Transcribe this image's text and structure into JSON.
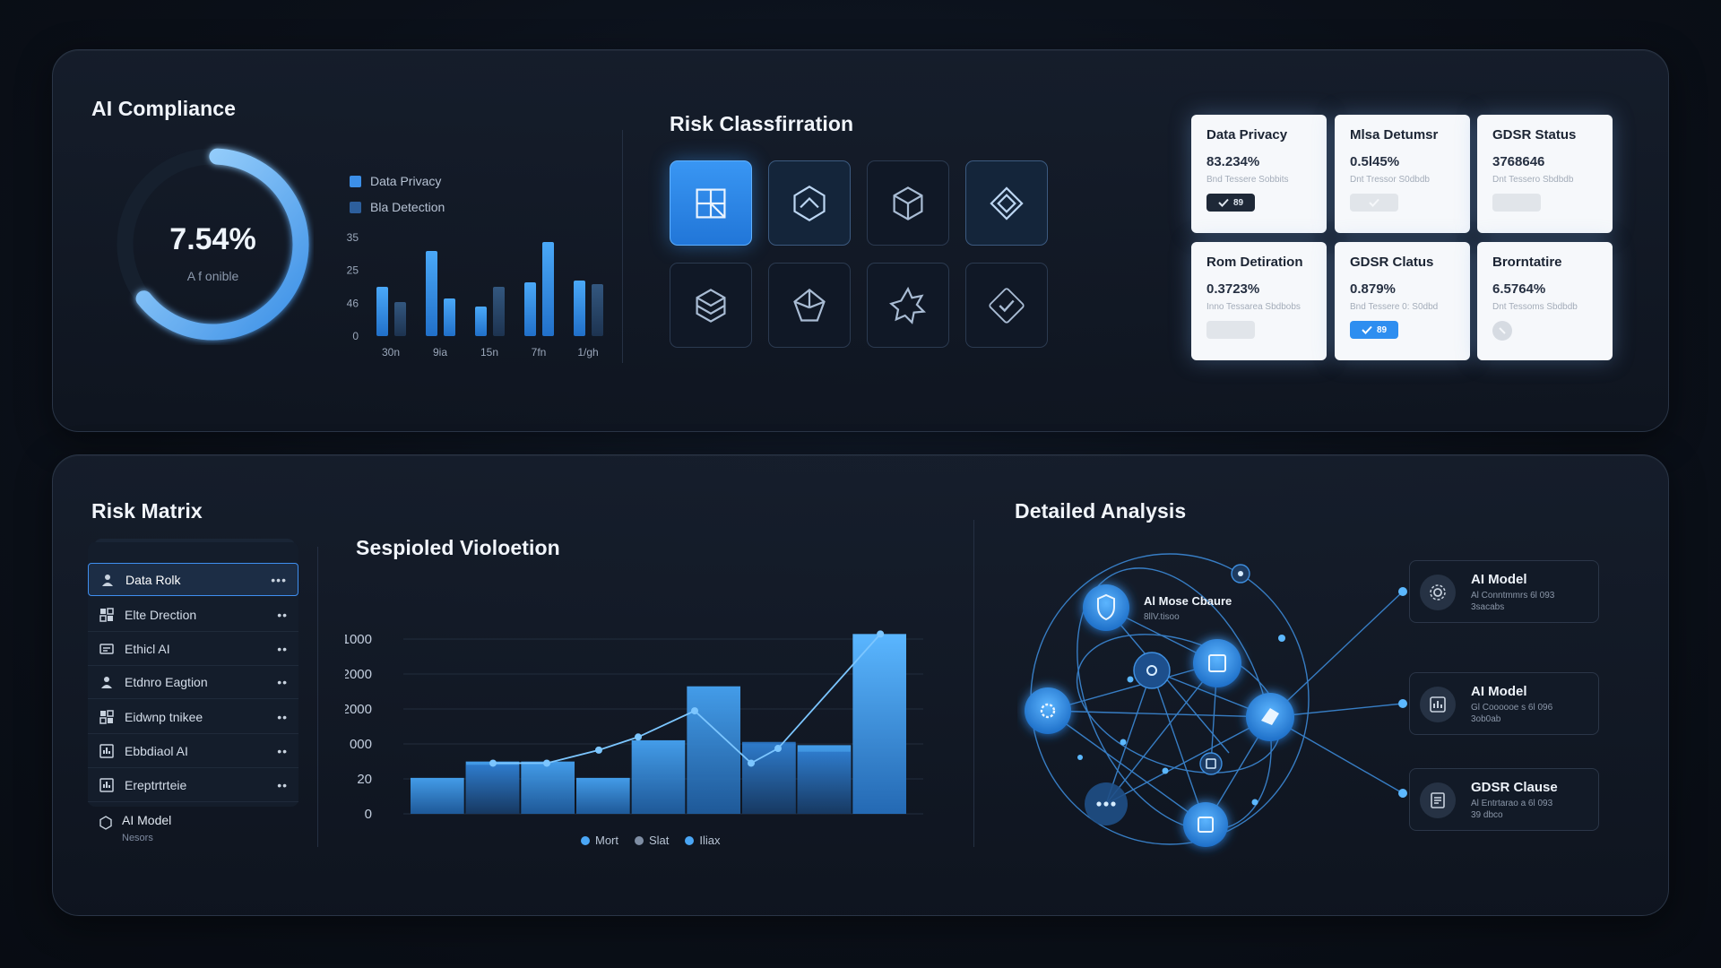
{
  "compliance": {
    "title": "AI Compliance",
    "gauge_value": "7.54%",
    "gauge_fraction": 0.58,
    "gauge_sub": "A f onible",
    "legend": [
      {
        "label": "Data Privacy",
        "color": "#3c8fe8"
      },
      {
        "label": "Bla Detection",
        "color": "#2d5f9c"
      }
    ]
  },
  "risk_classification": {
    "title": "Risk Classfirration",
    "tiles": [
      {
        "icon": "layout-blocks-icon",
        "state": "active"
      },
      {
        "icon": "hexagon-chevron-icon",
        "state": "highlight"
      },
      {
        "icon": "isometric-cube-icon",
        "state": "normal"
      },
      {
        "icon": "rotated-diamond-icon",
        "state": "highlight"
      },
      {
        "icon": "hexagon-layers-icon",
        "state": "normal"
      },
      {
        "icon": "prism-icon",
        "state": "normal"
      },
      {
        "icon": "gear-star-icon",
        "state": "normal"
      },
      {
        "icon": "shield-check-icon",
        "state": "normal"
      }
    ]
  },
  "status_cards": [
    {
      "title": "Data Privacy",
      "value": "83.234%",
      "sub": "Bnd Tessere Sobbits",
      "badge": "check-dark",
      "badge_text": "89"
    },
    {
      "title": "Mlsa Detumsr",
      "value": "0.5l45%",
      "sub": "Dnt Tressor S0dbdb",
      "badge": "grey",
      "badge_text": ""
    },
    {
      "title": "GDSR Status",
      "value": "3768646",
      "sub": "Dnt Tessero Sbdbdb",
      "badge": "grey",
      "badge_text": ""
    },
    {
      "title": "Rom Detiration",
      "value": "0.3723%",
      "sub": "Inno Tessarea Sbdbobs",
      "badge": "grey",
      "badge_text": ""
    },
    {
      "title": "GDSR Clatus",
      "value": "0.879%",
      "sub": "Bnd Tessere 0: S0dbd",
      "badge": "check-blue",
      "badge_text": "89"
    },
    {
      "title": "Brorntatire",
      "value": "6.5764%",
      "sub": "Dnt Tessoms Sbdbdb",
      "badge": "dot",
      "badge_text": ""
    }
  ],
  "risk_matrix": {
    "title": "Risk Matrix",
    "items": [
      {
        "label": "Data Rolk",
        "icon": "users-icon",
        "selected": true
      },
      {
        "label": "Elte Drection",
        "icon": "grid-chart-icon",
        "selected": false
      },
      {
        "label": "Ethicl AI",
        "icon": "id-card-icon",
        "selected": false
      },
      {
        "label": "Etdnro Eagtion",
        "icon": "users-icon",
        "selected": false
      },
      {
        "label": "Eidwnp tnikee",
        "icon": "grid-chart-icon",
        "selected": false
      },
      {
        "label": "Ebbdiaol AI",
        "icon": "chart-box-icon",
        "selected": false
      },
      {
        "label": "Ereptrtrteie",
        "icon": "chart-box-icon",
        "selected": false
      }
    ],
    "dots_label": "•••",
    "dots_label_small": "••",
    "footer": {
      "label": "AI Model",
      "sub": "Nesors",
      "icon": "hexagon-outline-icon"
    }
  },
  "violation_chart": {
    "title": "Sespioled Violoetion",
    "legend": [
      {
        "label": "Mort",
        "color": "#4aa6f5"
      },
      {
        "label": "Slat",
        "color": "#7f8ea4"
      },
      {
        "label": "Iliax",
        "color": "#4aa6f5"
      }
    ]
  },
  "chart_data": {
    "type": "bar",
    "title": "Sespioled Violoetion",
    "y_tick_labels": [
      "1000",
      "2000",
      "2000",
      "000",
      "20",
      "0"
    ],
    "series": [
      {
        "name": "Mort",
        "type": "bar",
        "values": [
          22,
          32,
          32,
          22,
          45,
          78,
          43,
          42,
          110
        ]
      },
      {
        "name": "Iliax",
        "type": "line",
        "values": [
          31,
          31,
          39,
          47,
          63,
          31,
          40,
          110
        ]
      }
    ],
    "overlay_bars": [
      30,
      44,
      38
    ],
    "ylim": [
      0,
      125
    ],
    "grid": true,
    "legend_position": "bottom-center"
  },
  "compliance_bars": {
    "y_tick_labels": [
      "35",
      "25",
      "46",
      "0"
    ],
    "x_tick_labels": [
      "30n",
      "9ia",
      "15n",
      "7fn",
      "1/gh"
    ],
    "groups": [
      [
        0.55,
        0.38
      ],
      [
        0.95,
        0.42
      ],
      [
        0.33,
        0.55
      ],
      [
        0.6,
        1.05
      ],
      [
        0.62,
        0.58
      ]
    ],
    "ylim": [
      0,
      1.1
    ]
  },
  "detailed_analysis": {
    "title": "Detailed Analysis",
    "network_label": "Al Mose Cbaure",
    "network_sub": "8llV.tisoo",
    "cards": [
      {
        "title": "AI Model",
        "sub1": "Al Conntmmrs 6l 093",
        "sub2": "3sacabs",
        "icon": "gear-icon"
      },
      {
        "title": "AI Model",
        "sub1": "Gl Coooooe s 6l 096",
        "sub2": "3ob0ab",
        "icon": "chart-box-icon"
      },
      {
        "title": "GDSR Clause",
        "sub1": "Al Entrtarao a 6l 093",
        "sub2": "39 dbco",
        "icon": "document-icon"
      }
    ]
  }
}
